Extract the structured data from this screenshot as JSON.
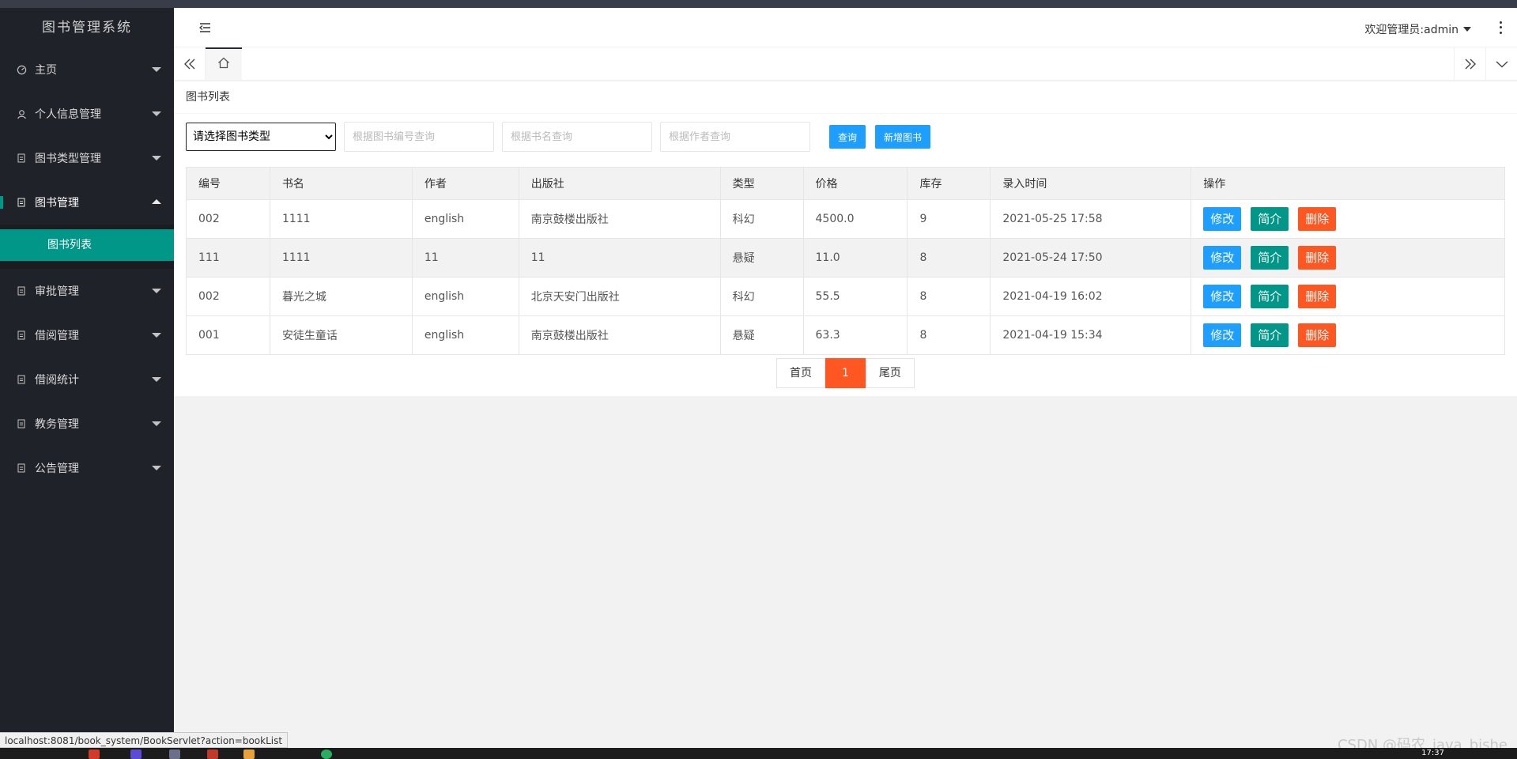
{
  "app": {
    "title": "图书管理系统"
  },
  "sidebar": {
    "items": [
      {
        "label": "主页",
        "icon": "dashboard-icon"
      },
      {
        "label": "个人信息管理",
        "icon": "user-icon"
      },
      {
        "label": "图书类型管理",
        "icon": "file-icon"
      },
      {
        "label": "图书管理",
        "icon": "file-icon",
        "open": true
      },
      {
        "label": "审批管理",
        "icon": "file-icon"
      },
      {
        "label": "借阅管理",
        "icon": "file-icon"
      },
      {
        "label": "借阅统计",
        "icon": "file-icon"
      },
      {
        "label": "教务管理",
        "icon": "file-icon"
      },
      {
        "label": "公告管理",
        "icon": "file-icon"
      }
    ],
    "sub_items": [
      {
        "label": "图书列表"
      }
    ]
  },
  "header": {
    "welcome": "欢迎管理员:admin"
  },
  "breadcrumb": "图书列表",
  "filters": {
    "type_select": "请选择图书类型",
    "id_placeholder": "根据图书编号查询",
    "name_placeholder": "根据书名查询",
    "author_placeholder": "根据作者查询",
    "search_label": "查询",
    "add_label": "新增图书"
  },
  "table": {
    "headers": [
      "编号",
      "书名",
      "作者",
      "出版社",
      "类型",
      "价格",
      "库存",
      "录入时间",
      "操作"
    ],
    "rows": [
      [
        "002",
        "1111",
        "english",
        "南京鼓楼出版社",
        "科幻",
        "4500.0",
        "9",
        "2021-05-25 17:58"
      ],
      [
        "111",
        "1111",
        "11",
        "11",
        "悬疑",
        "11.0",
        "8",
        "2021-05-24 17:50"
      ],
      [
        "002",
        "暮光之城",
        "english",
        "北京天安门出版社",
        "科幻",
        "55.5",
        "8",
        "2021-04-19 16:02"
      ],
      [
        "001",
        "安徒生童话",
        "english",
        "南京鼓楼出版社",
        "悬疑",
        "63.3",
        "8",
        "2021-04-19 15:34"
      ]
    ],
    "actions": {
      "edit": "修改",
      "intro": "简介",
      "delete": "删除"
    }
  },
  "pager": {
    "first": "首页",
    "current": "1",
    "last": "尾页"
  },
  "statusbar": {
    "url": "localhost:8081/book_system/BookServlet?action=bookList"
  },
  "watermark": "CSDN @码农_java_bishe",
  "clock": "17:37",
  "colors": {
    "sidebar_bg": "#20222a",
    "accent": "#009688",
    "primary": "#1e9fff",
    "danger": "#ff5722"
  }
}
